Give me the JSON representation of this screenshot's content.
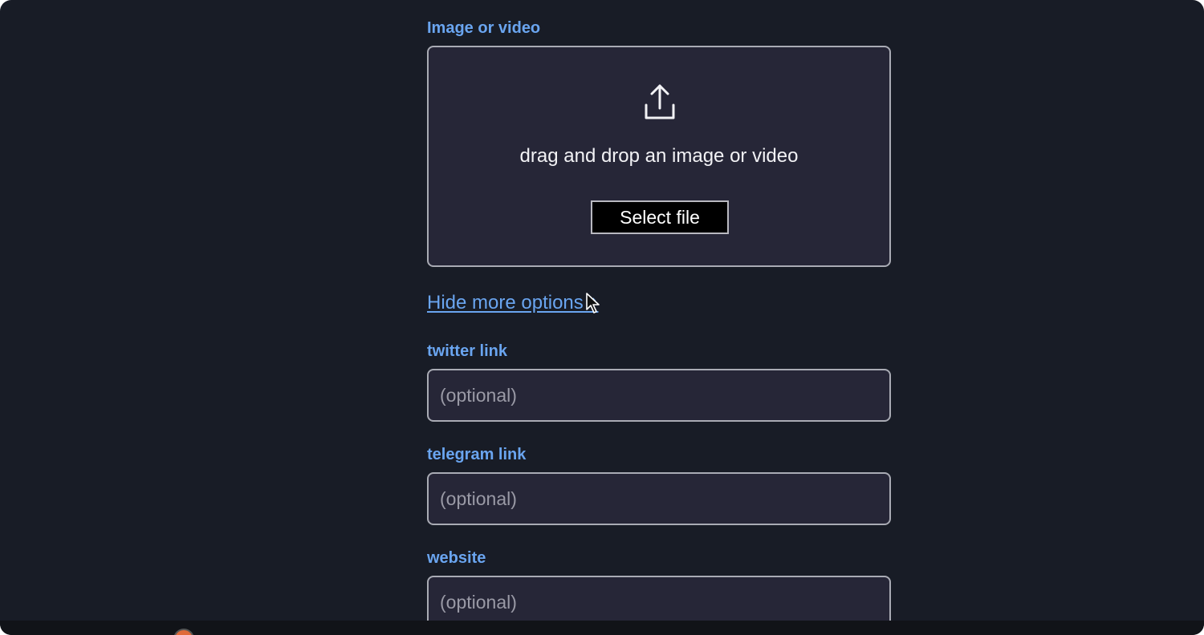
{
  "media": {
    "label": "Image or video",
    "dropzone_text": "drag and drop an image or video",
    "select_button": "Select file",
    "upload_icon": "upload-icon"
  },
  "options_toggle": {
    "label": "Hide more options ↑"
  },
  "fields": {
    "twitter": {
      "label": "twitter link",
      "placeholder": "(optional)",
      "value": ""
    },
    "telegram": {
      "label": "telegram link",
      "placeholder": "(optional)",
      "value": ""
    },
    "website": {
      "label": "website",
      "placeholder": "(optional)",
      "value": ""
    }
  },
  "colors": {
    "background": "#181c26",
    "accent": "#6aa5f0",
    "field_background": "#262637",
    "border": "#a9abb4"
  }
}
